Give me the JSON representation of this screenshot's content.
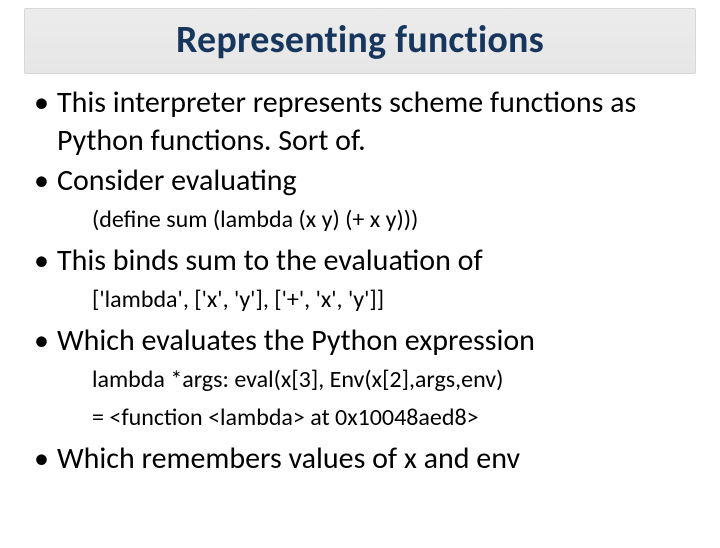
{
  "title": "Representing functions",
  "bullets": {
    "b1": "This interpreter represents scheme functions as Python functions.  Sort of.",
    "b2": "Consider evaluating",
    "b2_sub": "(define sum (lambda (x y) (+ x y)))",
    "b3": "This binds sum to the evaluation of",
    "b3_sub": "['lambda', ['x', 'y'], ['+', 'x', 'y']]",
    "b4": "Which evaluates the Python expression",
    "b4_sub_a": "lambda *args: eval(x[3], Env(x[2],args,env)",
    "b4_sub_b": "= <function <lambda> at 0x10048aed8>",
    "b5": "Which remembers values of x and env"
  },
  "glyph": "•"
}
